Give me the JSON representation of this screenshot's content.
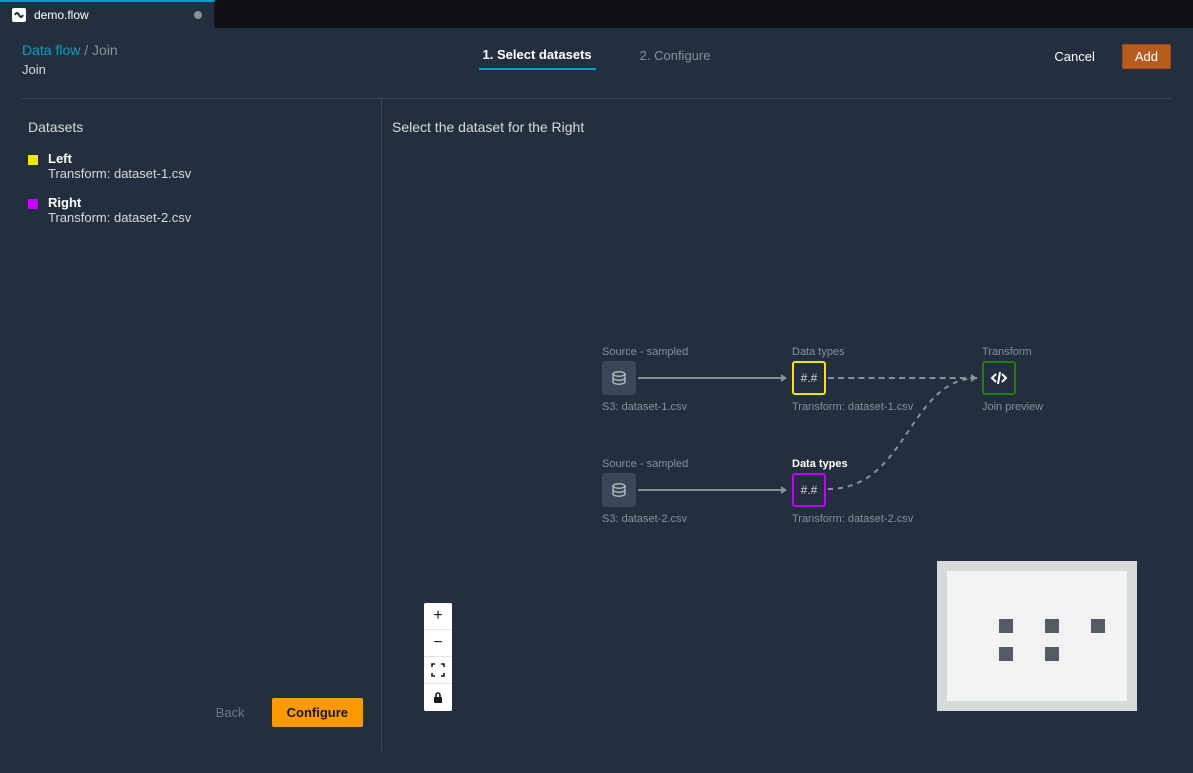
{
  "tab": {
    "filename": "demo.flow"
  },
  "breadcrumb": {
    "root": "Data flow",
    "separator": "/",
    "current": "Join"
  },
  "subheader": {
    "title": "Join"
  },
  "steps": {
    "step1": "1. Select datasets",
    "step2": "2. Configure"
  },
  "actions": {
    "cancel": "Cancel",
    "add": "Add",
    "back": "Back",
    "configure": "Configure"
  },
  "left": {
    "heading": "Datasets",
    "items": [
      {
        "label": "Left",
        "sub": "Transform: dataset-1.csv"
      },
      {
        "label": "Right",
        "sub": "Transform: dataset-2.csv"
      }
    ]
  },
  "canvas": {
    "title": "Select the dataset for the Right",
    "columns": {
      "source": "Source - sampled",
      "datatypes": "Data types",
      "transform": "Transform"
    },
    "nodeGlyph": "#.#",
    "captions": {
      "s3_1": "S3: dataset-1.csv",
      "s3_2": "S3: dataset-2.csv",
      "dt_1": "Transform: dataset-1.csv",
      "dt_2": "Transform: dataset-2.csv",
      "join": "Join preview"
    }
  }
}
